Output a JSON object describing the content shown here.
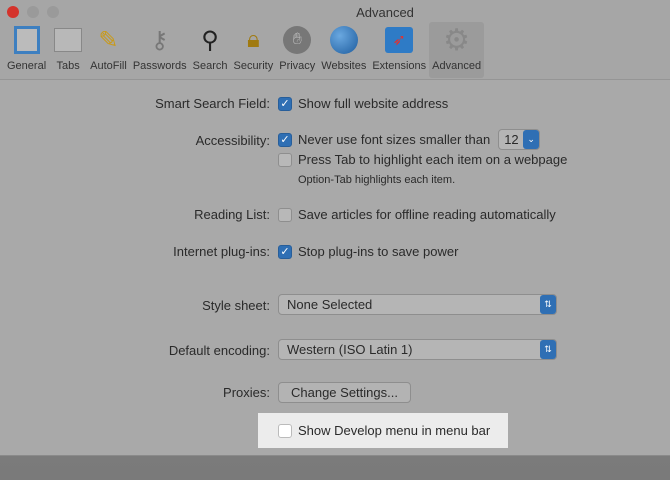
{
  "window": {
    "title": "Advanced"
  },
  "toolbar": [
    {
      "label": "General",
      "icon": "switch-icon"
    },
    {
      "label": "Tabs",
      "icon": "tabs-icon"
    },
    {
      "label": "AutoFill",
      "icon": "pencil-icon"
    },
    {
      "label": "Passwords",
      "icon": "key-icon"
    },
    {
      "label": "Search",
      "icon": "magnifier-icon"
    },
    {
      "label": "Security",
      "icon": "lock-icon"
    },
    {
      "label": "Privacy",
      "icon": "hand-icon"
    },
    {
      "label": "Websites",
      "icon": "globe-icon"
    },
    {
      "label": "Extensions",
      "icon": "puzzle-icon"
    },
    {
      "label": "Advanced",
      "icon": "gear-icon"
    }
  ],
  "settings": {
    "smart_search_label": "Smart Search Field:",
    "show_full_address": "Show full website address",
    "accessibility_label": "Accessibility:",
    "never_font": "Never use font sizes smaller than",
    "font_size": "12",
    "press_tab": "Press Tab to highlight each item on a webpage",
    "option_tab_note": "Option-Tab highlights each item.",
    "reading_list_label": "Reading List:",
    "save_articles": "Save articles for offline reading automatically",
    "plugins_label": "Internet plug-ins:",
    "stop_plugins": "Stop plug-ins to save power",
    "stylesheet_label": "Style sheet:",
    "stylesheet_value": "None Selected",
    "encoding_label": "Default encoding:",
    "encoding_value": "Western (ISO Latin 1)",
    "proxies_label": "Proxies:",
    "change_settings": "Change Settings...",
    "show_develop": "Show Develop menu in menu bar"
  }
}
